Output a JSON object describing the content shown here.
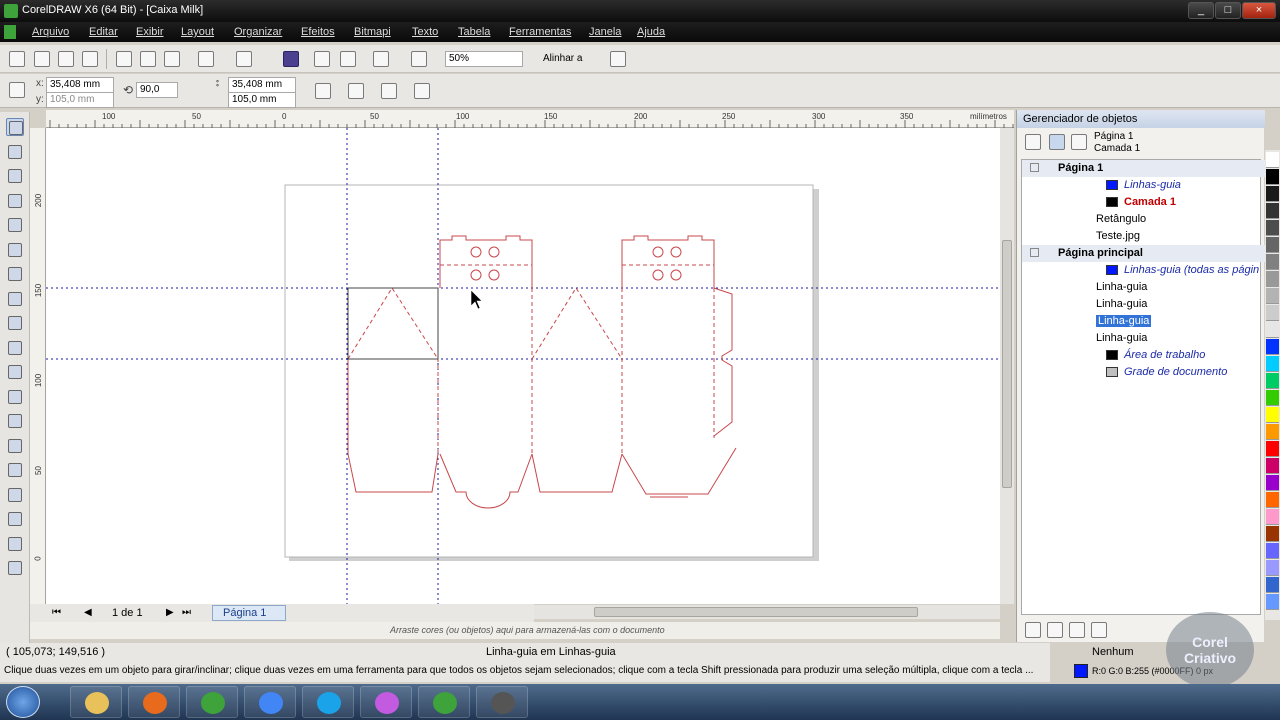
{
  "window": {
    "title": "CorelDRAW X6 (64 Bit) - [Caixa Milk]",
    "buttons": [
      "_",
      "□",
      "×"
    ]
  },
  "menu": [
    "Arquivo",
    "Editar",
    "Exibir",
    "Layout",
    "Organizar",
    "Efeitos",
    "Bitmapi",
    "Texto",
    "Tabela",
    "Ferramentas",
    "Janela",
    "Ajuda"
  ],
  "toolbar": {
    "zoom": "50%",
    "snap": "Alinhar a"
  },
  "propbar": {
    "x_label": "x:",
    "x": "35,408 mm",
    "y_label": "y:",
    "y": "105,0 mm",
    "rotation": "90,0",
    "w": "35,408 mm",
    "h": "105,0 mm"
  },
  "rulers": {
    "h_ticks": [
      "100",
      "50",
      "0",
      "50",
      "100",
      "150",
      "200",
      "250",
      "300",
      "350"
    ],
    "h_unit": "milímetros",
    "v_ticks": [
      "200",
      "150",
      "100",
      "50",
      "0"
    ],
    "v_unit": "milímetros"
  },
  "pagenav": {
    "page_count": "1 de 1",
    "tab": "Página 1"
  },
  "colortray": {
    "hint": "Arraste cores (ou objetos) aqui para armazená-las com o documento"
  },
  "status": {
    "coords": "( 105,073; 149,516 )",
    "selection": "Linha-guia em Linhas-guia",
    "fill": "Nenhum",
    "outline": "R:0 G:0 B:255 (#0000FF) 0 px",
    "hint": "Clique duas vezes em um objeto para girar/inclinar; clique duas vezes em uma ferramenta para que todos os objetos sejam selecionados; clique com a tecla Shift pressionada para produzir uma seleção múltipla, clique com a tecla ..."
  },
  "docker": {
    "title": "Gerenciador de objetos",
    "page": "Página 1",
    "layer": "Camada 1",
    "tree": [
      {
        "label": "Página 1",
        "bold": true,
        "indent": 1
      },
      {
        "label": "Linhas-guia",
        "italic": true,
        "color": "#1a2aa8",
        "indent": 3,
        "swatch": "#0018ff"
      },
      {
        "label": "Camada 1",
        "bold": true,
        "color": "#c00000",
        "indent": 3,
        "swatch": "#000000"
      },
      {
        "label": "Retângulo",
        "indent": 4
      },
      {
        "label": "Teste.jpg",
        "indent": 4
      },
      {
        "label": "Página principal",
        "bold": true,
        "indent": 1
      },
      {
        "label": "Linhas-guia (todas as págin",
        "italic": true,
        "color": "#1a2aa8",
        "indent": 3,
        "swatch": "#0018ff"
      },
      {
        "label": "Linha-guia",
        "indent": 4
      },
      {
        "label": "Linha-guia",
        "indent": 4
      },
      {
        "label": "Linha-guia",
        "indent": 4,
        "selected": true
      },
      {
        "label": "Linha-guia",
        "indent": 4
      },
      {
        "label": "Área de trabalho",
        "italic": true,
        "color": "#1a2aa8",
        "indent": 3,
        "swatch": "#000000"
      },
      {
        "label": "Grade de documento",
        "italic": true,
        "color": "#1a2aa8",
        "indent": 3,
        "swatch": "#c0c0c0"
      }
    ]
  },
  "watermark": "Corel Criativo",
  "palette": [
    "#ffffff",
    "#000000",
    "#1a1a1a",
    "#333333",
    "#4d4d4d",
    "#666666",
    "#808080",
    "#999999",
    "#b3b3b3",
    "#cccccc",
    "#e6e6e6",
    "#0033ff",
    "#00ccff",
    "#00cc66",
    "#33cc00",
    "#ffff00",
    "#ff9900",
    "#ff0000",
    "#cc0066",
    "#9900cc",
    "#ff6600",
    "#ff99cc",
    "#993300",
    "#6666ff",
    "#9999ff",
    "#3366cc",
    "#6699ff"
  ],
  "taskbar": [
    "explorer",
    "media-player",
    "coreldraw",
    "chrome",
    "skype",
    "paint",
    "coreldraw-doc",
    "corel-capture"
  ]
}
